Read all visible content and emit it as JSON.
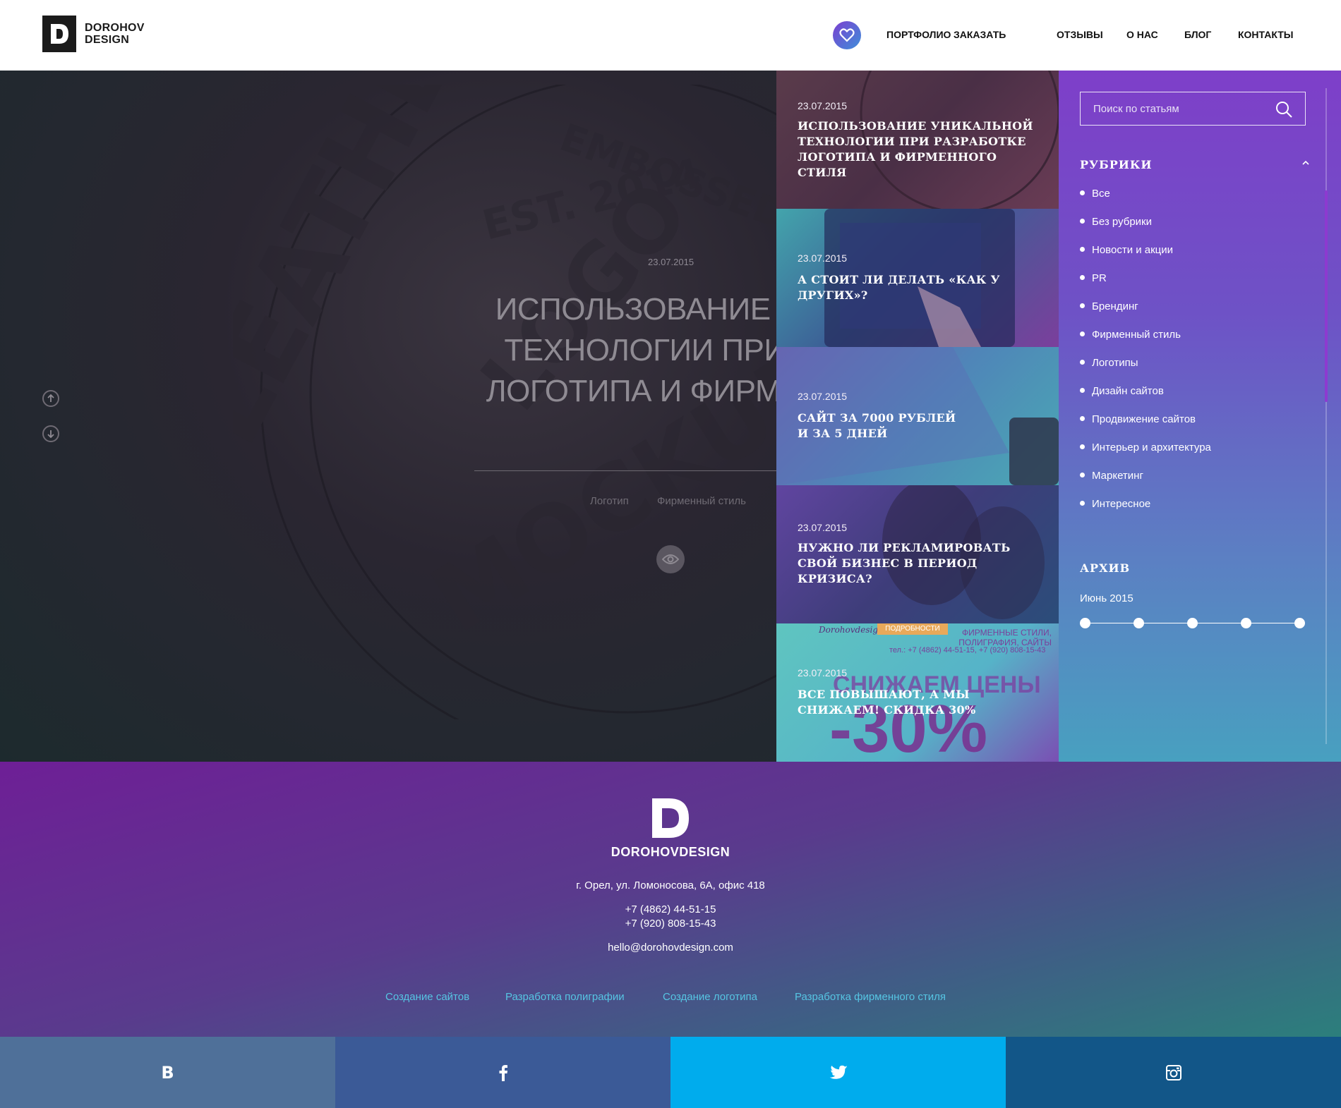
{
  "header": {
    "logo_line1": "DOROHOV",
    "logo_line2": "DESIGN",
    "nav": [
      "ПОРТФОЛИО",
      "ЗАКАЗАТЬ",
      "ОТЗЫВЫ",
      "О НАС",
      "БЛОГ",
      "КОНТАКТЫ"
    ]
  },
  "hero": {
    "date": "23.07.2015",
    "title_line1": "ИСПОЛЬЗОВАНИЕ УНИК",
    "title_line2": "ТЕХНОЛОГИИ ПРИ РАЗ",
    "title_line3": "ЛОГОТИПА И ФИРМЕННО",
    "tags": [
      "Логотип",
      "Фирменный стиль"
    ]
  },
  "cards": [
    {
      "date": "23.07.2015",
      "title": "ИСПОЛЬЗОВАНИЕ УНИКАЛЬНОЙ ТЕХНОЛОГИИ ПРИ РАЗРАБОТКЕ ЛОГОТИПА И ФИРМЕННОГО СТИЛЯ"
    },
    {
      "date": "23.07.2015",
      "title": "А СТОИТ ЛИ ДЕЛАТЬ «КАК У ДРУГИХ»?"
    },
    {
      "date": "23.07.2015",
      "title": "САЙТ ЗА 7000 РУБЛЕЙ И ЗА 5 ДНЕЙ"
    },
    {
      "date": "23.07.2015",
      "title": "НУЖНО ЛИ РЕКЛАМИРОВАТЬ СВОЙ БИЗНЕС В ПЕРИОД КРИЗИСА?"
    },
    {
      "date": "23.07.2015",
      "title": "ВСЕ ПОВЫШАЮТ, А МЫ СНИЖАЕМ! СКИДКА 30%"
    }
  ],
  "card5_bg": {
    "brand": "Dorohovdesign",
    "badge": "ПОДРОБНОСТИ",
    "services": "ФИРМЕННЫЕ СТИЛИ, ПОЛИГРАФИЯ, САЙТЫ",
    "phones": "тел.: +7 (4862) 44-51-15, +7 (920) 808-15-43",
    "promo": "СНИЖАЕМ ЦЕНЫ",
    "discount": "-30%"
  },
  "sidebar": {
    "search_placeholder": "Поиск по статьям",
    "rubrics_heading": "РУБРИКИ",
    "rubrics": [
      "Все",
      "Без рубрики",
      "Новости и акции",
      "PR",
      "Брендинг",
      "Фирменный стиль",
      "Логотипы",
      "Дизайн сайтов",
      "Продвижение сайтов",
      "Интерьер и архитектура",
      "Маркетинг",
      "Интересное"
    ],
    "archive_heading": "АРХИВ",
    "archive_month": "Июнь 2015"
  },
  "hero_emboss": {
    "line1": "EMBOSSED",
    "line2": "EST. 2014",
    "line3": "LEATHER",
    "line4": "LOGO",
    "line5": "MOCKUP"
  },
  "footer": {
    "brand": "DOROHOVDESIGN",
    "address": "г. Орел, ул. Ломоносова, 6А, офис 418",
    "phone1": "+7 (4862) 44-51-15",
    "phone2": "+7 (920) 808-15-43",
    "email": "hello@dorohovdesign.com",
    "links": [
      "Создание сайтов",
      "Разработка полиграфии",
      "Создание логотипа",
      "Разработка фирменного стиля"
    ]
  },
  "social": {
    "vk": "B",
    "colors": {
      "vk": "#4f7099",
      "facebook": "#3b5a97",
      "twitter": "#00aced",
      "instagram": "#125688"
    }
  }
}
